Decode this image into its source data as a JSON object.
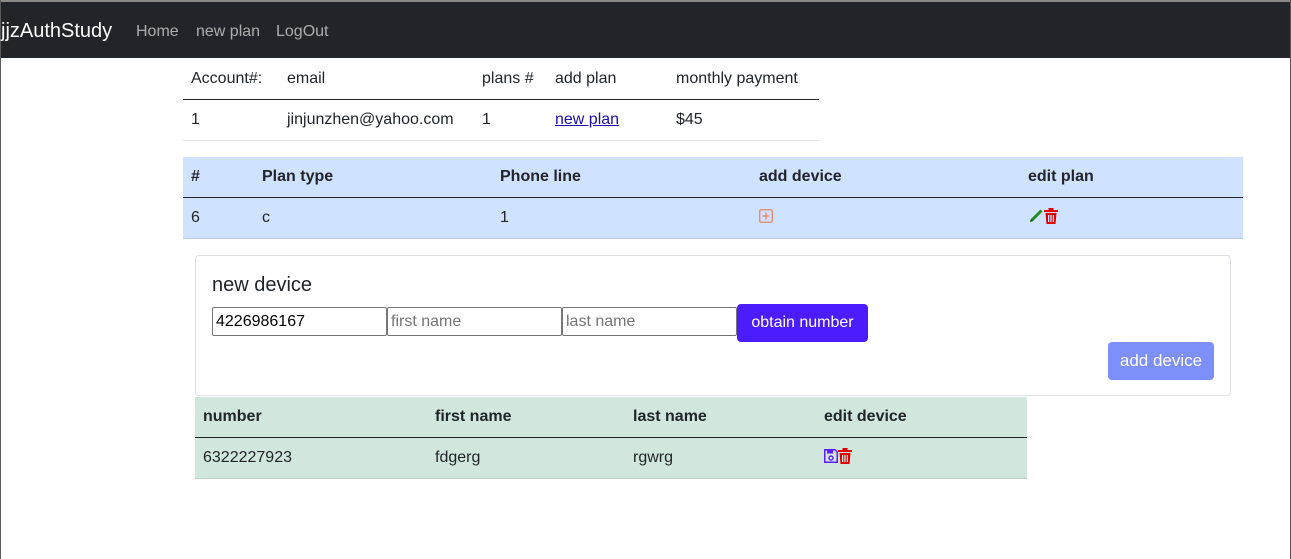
{
  "navbar": {
    "brand": "jjzAuthStudy",
    "links": [
      "Home",
      "new plan",
      "LogOut"
    ]
  },
  "account_table": {
    "headers": [
      "Account#:",
      "email",
      "plans #",
      "add plan",
      "monthly payment"
    ],
    "row": {
      "account": "1",
      "email": "jinjunzhen@yahoo.com",
      "plans": "1",
      "add_plan_link": "new plan",
      "monthly_payment": "$45"
    }
  },
  "plans_table": {
    "headers": [
      "#",
      "Plan type",
      "Phone line",
      "add device",
      "edit plan"
    ],
    "row": {
      "id": "6",
      "plan_type": "c",
      "phone_line": "1",
      "add_device_icon": "plus-square-icon",
      "edit_icons": [
        "pencil-icon",
        "trash-icon"
      ]
    }
  },
  "new_device": {
    "title": "new device",
    "number_value": "4226986167",
    "first_name_placeholder": "first name",
    "last_name_placeholder": "last name",
    "obtain_button": "obtain number",
    "add_button": "add device"
  },
  "devices_table": {
    "headers": [
      "number",
      "first name",
      "last name",
      "edit device"
    ],
    "rows": [
      {
        "number": "6322227923",
        "first_name": "fdgerg",
        "last_name": "rgwrg",
        "edit_icons": [
          "save-icon",
          "trash-icon"
        ]
      }
    ]
  },
  "colors": {
    "navbar_bg": "#212529",
    "plans_bg": "#cfe2ff",
    "devices_bg": "#d1e7dd",
    "primary_button": "#4b1dfc",
    "disabled_button": "#7d8ffb",
    "trash_icon": "#e00000",
    "pencil_icon": "#1a8a1a",
    "save_icon": "#5a1dfc",
    "plus_icon": "#e8826a"
  }
}
